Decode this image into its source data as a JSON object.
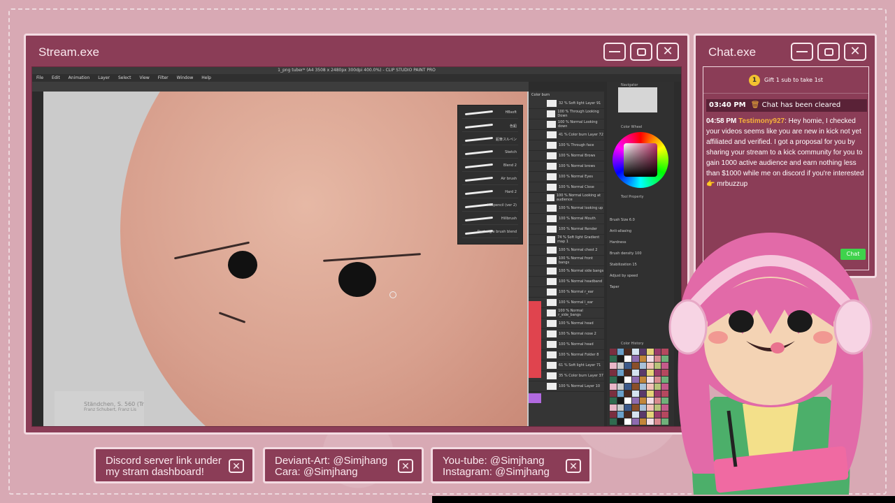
{
  "stream_window": {
    "title": "Stream.exe",
    "controls": {
      "minimize": "minimize",
      "maximize": "maximize",
      "close": "✕"
    },
    "app": {
      "title": "1_png tuber* (A4 3508 x 2480px 300dpi 400.0%) - CLIP STUDIO PAINT PRO",
      "menu": [
        "File",
        "Edit",
        "Animation",
        "Layer",
        "Select",
        "View",
        "Filter",
        "Window",
        "Help"
      ],
      "music_overlay": {
        "title": "Ständchen, S. 560 (Tr",
        "subtitle": "Franz Schubert, Franz Lis"
      },
      "subtool_brushes": [
        "HBsoft",
        "色鉛",
        "鉛筆スルペン",
        "Sketch",
        "Blend 2",
        "Air brush",
        "Hard 2",
        "HiBpencil (ver 2)",
        "Hillbrush",
        "Rectangle brush blend"
      ],
      "layers": [
        "32 % Soft light Layer 91",
        "100 % Through Looking Down",
        "100 % Normal Looking down",
        "41 % Color burn Layer 72",
        "100 % Through face",
        "100 % Normal Brows",
        "100 % Normal brows",
        "100 % Normal Eyes",
        "100 % Normal Close",
        "100 % Normal Looking at audience",
        "100 % Normal looking up",
        "100 % Normal Mouth",
        "100 % Normal Render",
        "74 % Soft light Gradient map 1",
        "100 % Normal chest 2",
        "100 % Normal front bangs",
        "100 % Normal side bangs",
        "100 % Normal headband",
        "100 % Normal r_ear",
        "100 % Normal l_ear",
        "100 % Normal r_side_bangs",
        "100 % Normal head",
        "100 % Normal nose 2",
        "100 % Normal head",
        "100 % Normal Folder 8",
        "61 % Soft light Layer 71",
        "35 % Color burn Layer 37",
        "100 % Normal Layer 10"
      ],
      "panels": {
        "navigator": "Navigator",
        "color_wheel": "Color Wheel",
        "tool_property": "Tool Property",
        "color_history": "Color History",
        "blend_mode": "Color burn"
      },
      "tool_property": {
        "brush_size": "Brush Size",
        "brush_size_value": "6.0",
        "antialiasing": "Anti-aliasing",
        "hardness": "Hardness",
        "brush_density": "Brush density",
        "brush_density_value": "100",
        "stabilization": "Stabilization",
        "stabilization_value": "15",
        "adjust_by_speed": "Adjust by speed",
        "taper": "Taper"
      }
    }
  },
  "chat_window": {
    "title": "Chat.exe",
    "pinned": {
      "coin": "1",
      "text": "Gift 1 sub to take 1st"
    },
    "system": {
      "time": "03:40 PM",
      "text": "Chat has been cleared"
    },
    "message": {
      "time": "04:58 PM",
      "user": "Testimony927",
      "text": ": Hey homie, I checked your videos seems like you are new in kick not yet affiliated and verified. I got a proposal for you by sharing your stream to a kick community for you to gain 1000 active audience and earn nothing less than $1000 while me on discord if you're interested 👉 mrbuzzup"
    },
    "chat_button": "Chat"
  },
  "links": [
    {
      "line1": "Discord server link under",
      "line2": "my stram dashboard!"
    },
    {
      "line1": "Deviant-Art: @Simjhang",
      "line2": "Cara: @Simjhang"
    },
    {
      "line1": "You-tube: @Simjhang",
      "line2": "Instagram: @Simjhang"
    }
  ],
  "colors": {
    "frame": "#8b3d57",
    "frame_border": "#f3dbe2",
    "background": "#d8a9b4",
    "username": "#f6b23a",
    "chat_button": "#3fd24c"
  }
}
